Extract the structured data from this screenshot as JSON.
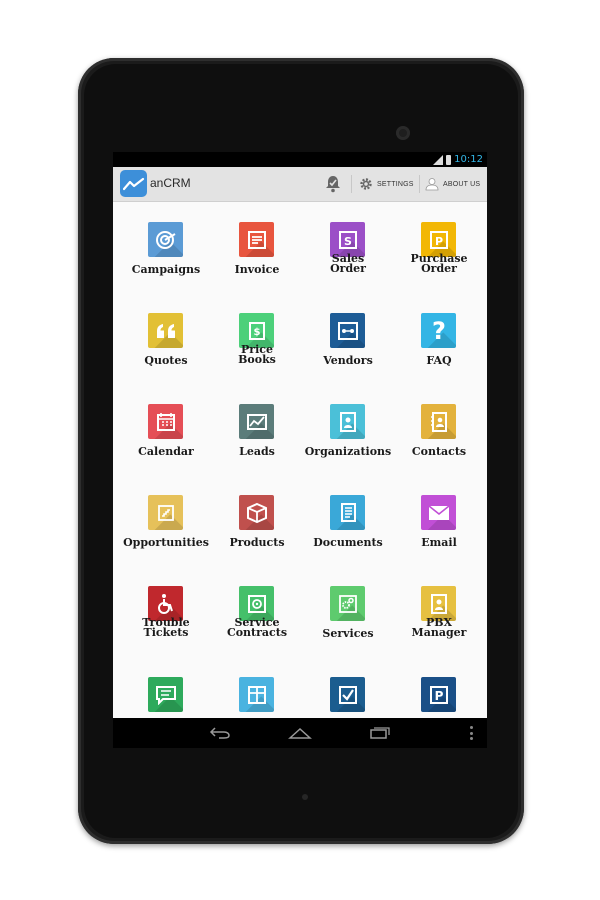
{
  "status_bar": {
    "time": "10:12"
  },
  "action_bar": {
    "app_title": "anCRM",
    "settings_label": "SETTINGS",
    "about_label": "ABOUT US"
  },
  "modules": [
    {
      "label": "Campaigns",
      "color": "#5b9bd5",
      "icon": "target-icon"
    },
    {
      "label": "Invoice",
      "color": "#e8553e",
      "icon": "invoice-icon"
    },
    {
      "label": "Sales Order",
      "color": "#9b4fc7",
      "icon": "sales-order-icon"
    },
    {
      "label": "Purchase Order",
      "color": "#f2b705",
      "icon": "purchase-order-icon"
    },
    {
      "label": "Quotes",
      "color": "#e2c035",
      "icon": "quote-icon"
    },
    {
      "label": "Price Books",
      "color": "#4cd07a",
      "icon": "price-book-icon"
    },
    {
      "label": "Vendors",
      "color": "#1d5c96",
      "icon": "vendors-icon"
    },
    {
      "label": "FAQ",
      "color": "#33b5e5",
      "icon": "question-icon"
    },
    {
      "label": "Calendar",
      "color": "#e54e56",
      "icon": "calendar-icon"
    },
    {
      "label": "Leads",
      "color": "#5b7c7a",
      "icon": "leads-icon"
    },
    {
      "label": "Organizations",
      "color": "#4bc0d8",
      "icon": "organization-icon"
    },
    {
      "label": "Contacts",
      "color": "#e3b23c",
      "icon": "contacts-icon"
    },
    {
      "label": "Opportunities",
      "color": "#e6c15a",
      "icon": "opportunities-icon"
    },
    {
      "label": "Products",
      "color": "#c0504d",
      "icon": "box-icon"
    },
    {
      "label": "Documents",
      "color": "#3aa8d8",
      "icon": "documents-icon"
    },
    {
      "label": "Email",
      "color": "#c14fd6",
      "icon": "envelope-icon"
    },
    {
      "label": "Trouble Tickets",
      "color": "#c0282d",
      "icon": "wheelchair-icon"
    },
    {
      "label": "Service Contracts",
      "color": "#45c06a",
      "icon": "safe-icon"
    },
    {
      "label": "Services",
      "color": "#5ecb6e",
      "icon": "gears-icon"
    },
    {
      "label": "PBX Manager",
      "color": "#e6c040",
      "icon": "pbx-icon"
    },
    {
      "label": "",
      "color": "#2eaa5c",
      "icon": "comment-icon"
    },
    {
      "label": "",
      "color": "#4ab3e0",
      "icon": "gift-icon"
    },
    {
      "label": "",
      "color": "#1b5d8f",
      "icon": "checkbox-icon"
    },
    {
      "label": "",
      "color": "#1a4f87",
      "icon": "parking-icon"
    }
  ]
}
